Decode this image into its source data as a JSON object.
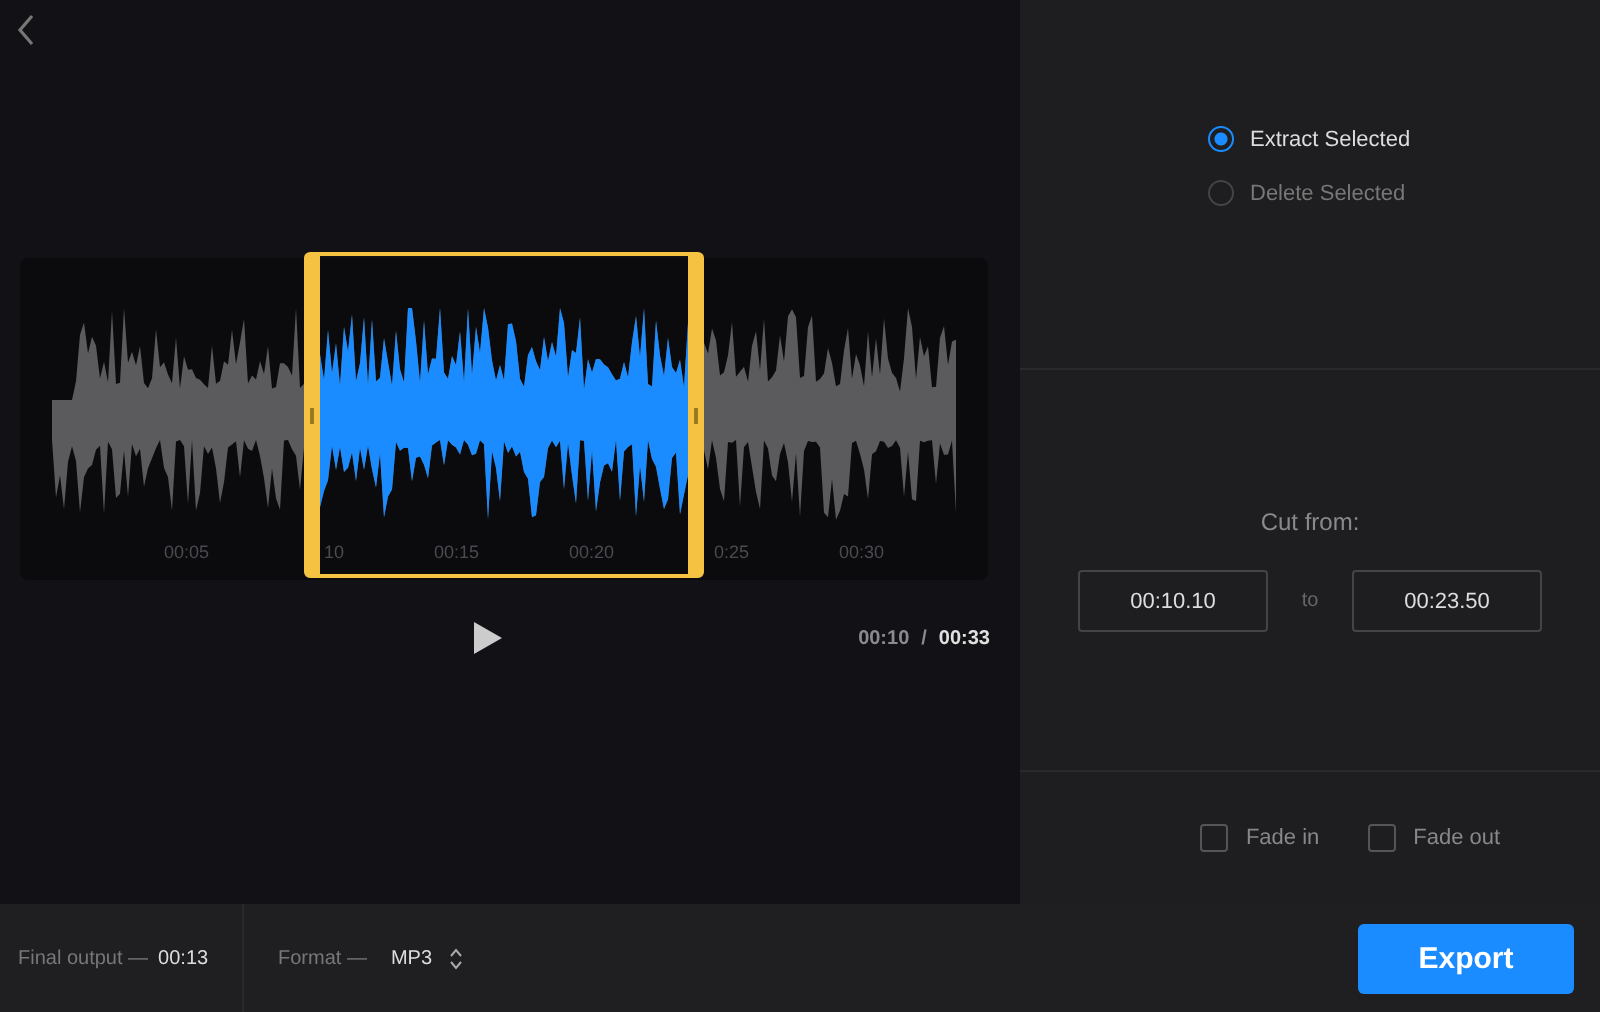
{
  "editor": {
    "timeline_ticks": [
      "00:05",
      "10",
      "00:15",
      "00:20",
      "0:25",
      "00:30"
    ],
    "time_current": "00:10",
    "time_separator": "/",
    "time_total": "00:33"
  },
  "mode_options": [
    {
      "label": "Extract Selected",
      "selected": true
    },
    {
      "label": "Delete Selected",
      "selected": false
    }
  ],
  "cut": {
    "label": "Cut from:",
    "start": "00:10.10",
    "separator": "to",
    "end": "00:23.50"
  },
  "fades": [
    {
      "label": "Fade in",
      "checked": false
    },
    {
      "label": "Fade out",
      "checked": false
    }
  ],
  "status_bar": {
    "output_label": "Final output —",
    "output_value": "00:13",
    "format_label": "Format —",
    "format_value": "MP3",
    "export_button": "Export"
  }
}
